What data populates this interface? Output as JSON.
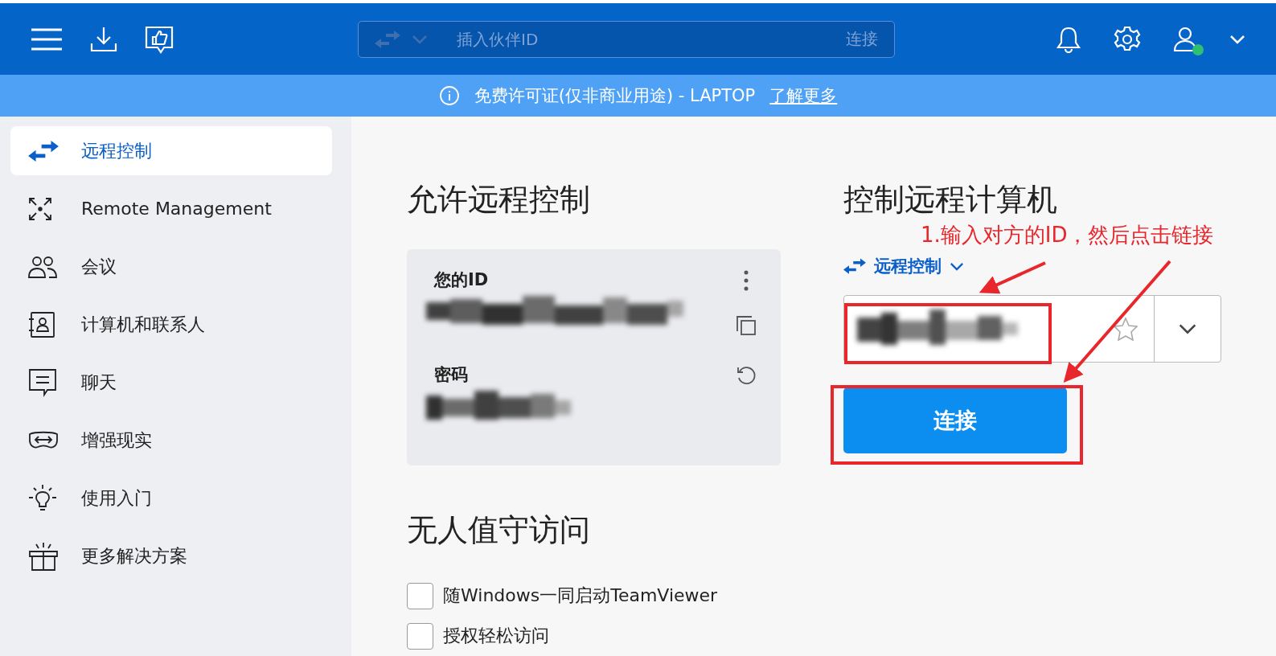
{
  "top_bar": {
    "partner_id_field": {
      "placeholder": "插入伙伴ID",
      "action": "连接"
    },
    "user_online": true
  },
  "banner": {
    "text": "免费许可证(仅非商业用途) - LAPTOP",
    "link": "了解更多"
  },
  "sidebar": {
    "items": [
      {
        "label": "远程控制",
        "selected": true
      },
      {
        "label": "Remote Management",
        "selected": false
      },
      {
        "label": "会议",
        "selected": false
      },
      {
        "label": "计算机和联系人",
        "selected": false
      },
      {
        "label": "聊天",
        "selected": false
      },
      {
        "label": "增强现实",
        "selected": false
      },
      {
        "label": "使用入门",
        "selected": false
      },
      {
        "label": "更多解决方案",
        "selected": false
      }
    ]
  },
  "allow_remote": {
    "title": "允许远程控制",
    "id_label": "您的ID",
    "password_label": "密码"
  },
  "control_remote": {
    "title": "控制远程计算机",
    "mode": "远程控制",
    "connect_button": "连接"
  },
  "unattended": {
    "title": "无人值守访问",
    "options": [
      {
        "label": "随Windows一同启动TeamViewer",
        "checked": false
      },
      {
        "label": "授权轻松访问",
        "checked": false
      }
    ]
  },
  "annotation": {
    "text": "1.输入对方的ID，然后点击链接"
  }
}
